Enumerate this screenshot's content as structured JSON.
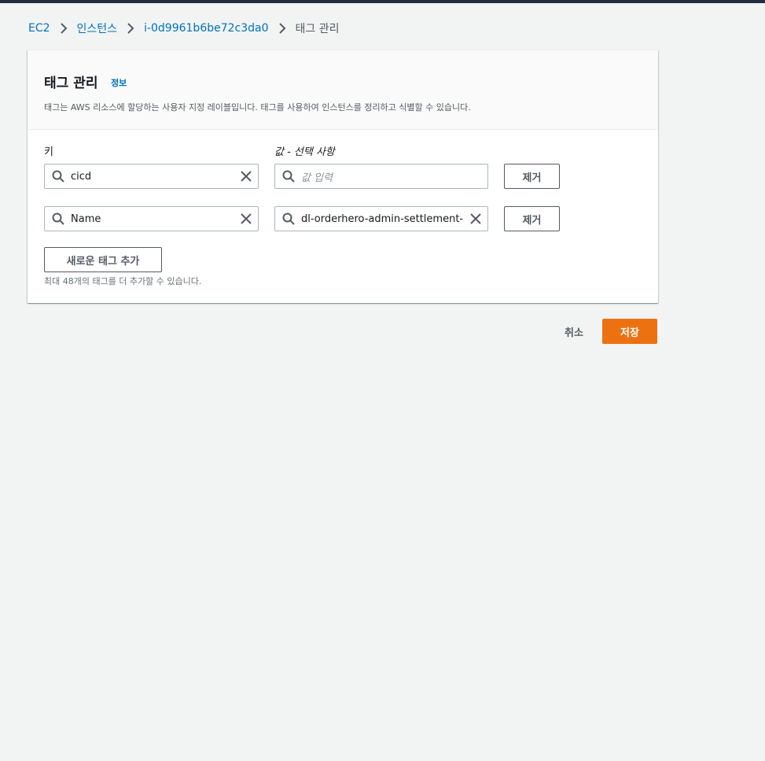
{
  "breadcrumb": {
    "items": [
      {
        "label": "EC2"
      },
      {
        "label": "인스턴스"
      },
      {
        "label": "i-0d9961b6be72c3da0"
      },
      {
        "label": "태그 관리"
      }
    ]
  },
  "panel": {
    "title": "태그 관리",
    "info_link": "정보",
    "description": "태그는 AWS 리소스에 할당하는 사용자 지정 레이블입니다. 태그를 사용하여 인스턴스를 정리하고 식별할 수 있습니다.",
    "key_label": "키",
    "value_label": "값 - 선택 사항",
    "tags": [
      {
        "key": "cicd",
        "value": "",
        "value_placeholder": "값 입력",
        "remove_label": "제거"
      },
      {
        "key": "Name",
        "value": "dl-orderhero-admin-settlement-",
        "value_placeholder": "값 입력",
        "remove_label": "제거"
      }
    ],
    "add_tag_label": "새로운 태그 추가",
    "hint": "최대 48개의 태그를 더 추가할 수 있습니다."
  },
  "footer": {
    "cancel_label": "취소",
    "save_label": "저장"
  },
  "colors": {
    "link": "#0073bb",
    "primary": "#ec7211",
    "topbar": "#232f3e",
    "background": "#f2f3f3"
  },
  "icons": {
    "search": "search-icon",
    "clear": "close-icon",
    "separator": "chevron-right-icon"
  }
}
